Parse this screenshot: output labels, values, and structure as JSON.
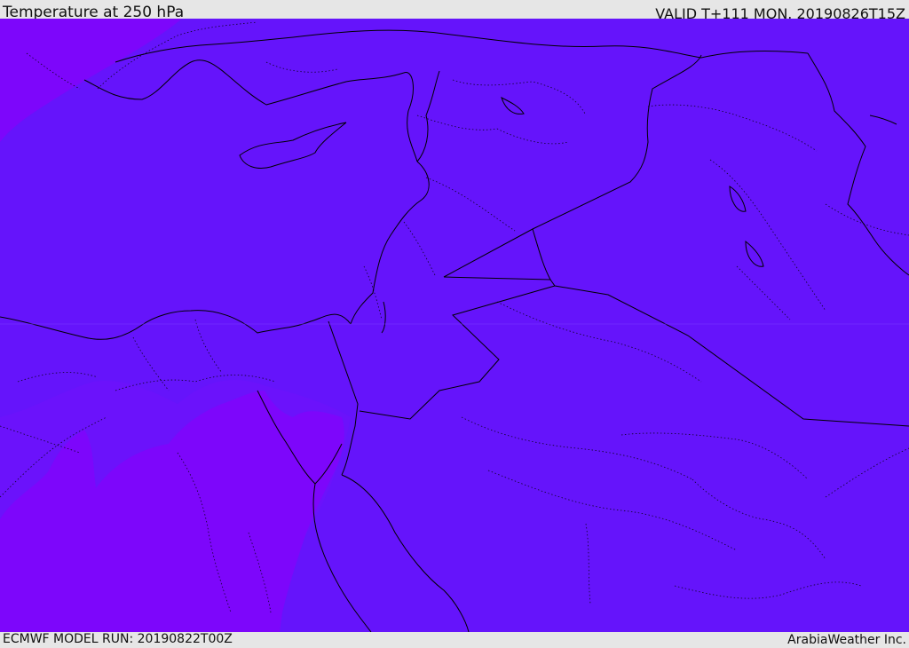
{
  "header": {
    "title": "Temperature at 250 hPa",
    "valid_time": "VALID T+111 MON. 20190826T15Z"
  },
  "footer": {
    "model_run": "ECMWF MODEL RUN: 20190822T00Z",
    "credit": "ArabiaWeather Inc."
  },
  "colors": {
    "field_main": "#6514fb",
    "field_warm": "#7d06fb",
    "field_transition": "#7110fb",
    "border_line": "#000000"
  }
}
